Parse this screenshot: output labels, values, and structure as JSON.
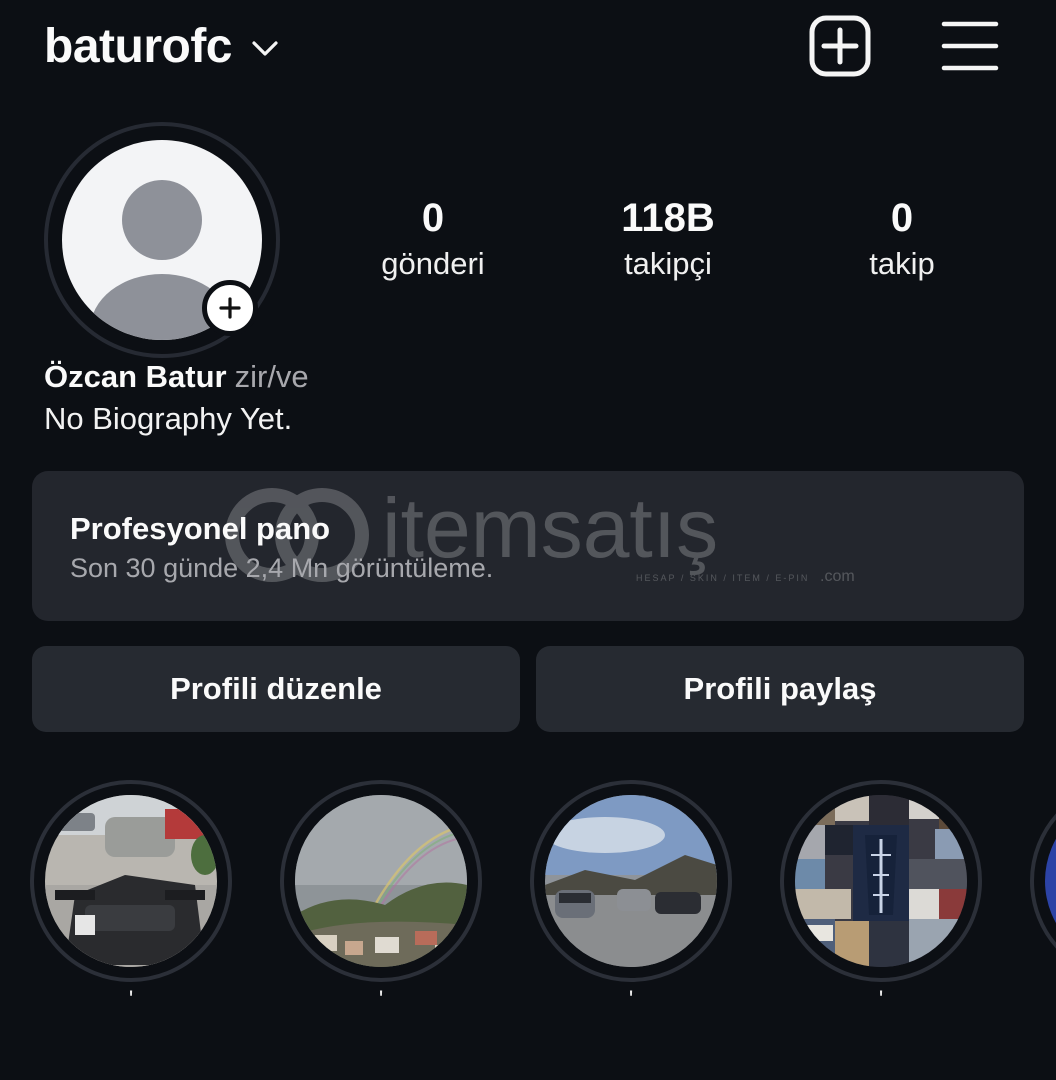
{
  "header": {
    "username": "baturofc",
    "icons": {
      "account_switcher": "chevron-down-icon",
      "new_post": "plus-square-icon",
      "menu": "hamburger-menu-icon"
    }
  },
  "profile": {
    "full_name": "Özcan Batur",
    "pronouns": "zir/ve",
    "bio": "No Biography Yet.",
    "avatar_icon": "default-avatar-icon"
  },
  "stats": {
    "posts": {
      "value": "0",
      "label": "gönderi"
    },
    "followers": {
      "value": "118B",
      "label": "takipçi"
    },
    "following": {
      "value": "0",
      "label": "takip"
    }
  },
  "dashboard": {
    "title": "Profesyonel pano",
    "subtitle": "Son 30 günde 2,4 Mn görüntüleme."
  },
  "watermark": {
    "brand": "itemsatış",
    "tagline": "HESAP / SKIN / ITEM / E-PIN",
    "suffix": ".com"
  },
  "buttons": {
    "edit_profile": "Profili düzenle",
    "share_profile": "Profili paylaş"
  },
  "highlights": [
    {
      "label": "'"
    },
    {
      "label": "'"
    },
    {
      "label": "'"
    },
    {
      "label": "'"
    }
  ],
  "colors": {
    "background": "#0c0f14",
    "card": "#23262d",
    "button": "#262a31",
    "text_primary": "#fafafa",
    "text_secondary": "#a8a8ad"
  }
}
